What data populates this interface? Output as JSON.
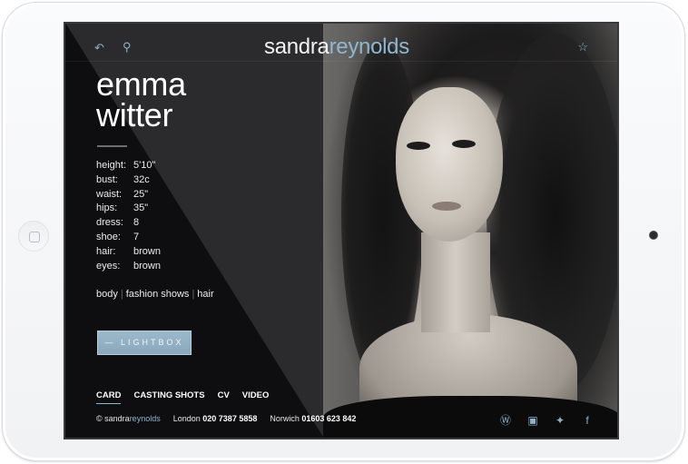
{
  "brand": {
    "part1": "sandra",
    "part2": "reynolds"
  },
  "header": {
    "back_icon": "back-arrow-icon",
    "search_icon": "search-icon",
    "star_icon": "star-icon"
  },
  "model": {
    "first_name": "emma",
    "last_name": "witter",
    "stats": [
      {
        "label": "height:",
        "value": "5'10\""
      },
      {
        "label": "bust:",
        "value": "32c"
      },
      {
        "label": "waist:",
        "value": "25\""
      },
      {
        "label": "hips:",
        "value": "35\""
      },
      {
        "label": "dress:",
        "value": "8"
      },
      {
        "label": "shoe:",
        "value": "7"
      },
      {
        "label": "hair:",
        "value": "brown"
      },
      {
        "label": "eyes:",
        "value": "brown"
      }
    ],
    "tags": [
      "body",
      "fashion shows",
      "hair"
    ],
    "tag_separator": "|"
  },
  "lightbox_button": "— LIGHTBOX",
  "tabs": [
    {
      "label": "CARD",
      "active": true
    },
    {
      "label": "CASTING SHOTS",
      "active": false
    },
    {
      "label": "CV",
      "active": false
    },
    {
      "label": "VIDEO",
      "active": false
    }
  ],
  "footer": {
    "copyright_symbol": "©",
    "brand1": "sandra",
    "brand2": "reynolds",
    "london_label": "London",
    "london_phone": "020 7387 5858",
    "norwich_label": "Norwich",
    "norwich_phone": "01603 623 842"
  },
  "social": [
    {
      "name": "wordpress-icon",
      "glyph": "Ⓦ"
    },
    {
      "name": "youtube-icon",
      "glyph": "▣"
    },
    {
      "name": "twitter-icon",
      "glyph": "🐦"
    },
    {
      "name": "facebook-icon",
      "glyph": "f"
    }
  ],
  "colors": {
    "accent": "#8fb6cf",
    "panel": "#2b2b2d",
    "dark": "#0e0d0f"
  }
}
